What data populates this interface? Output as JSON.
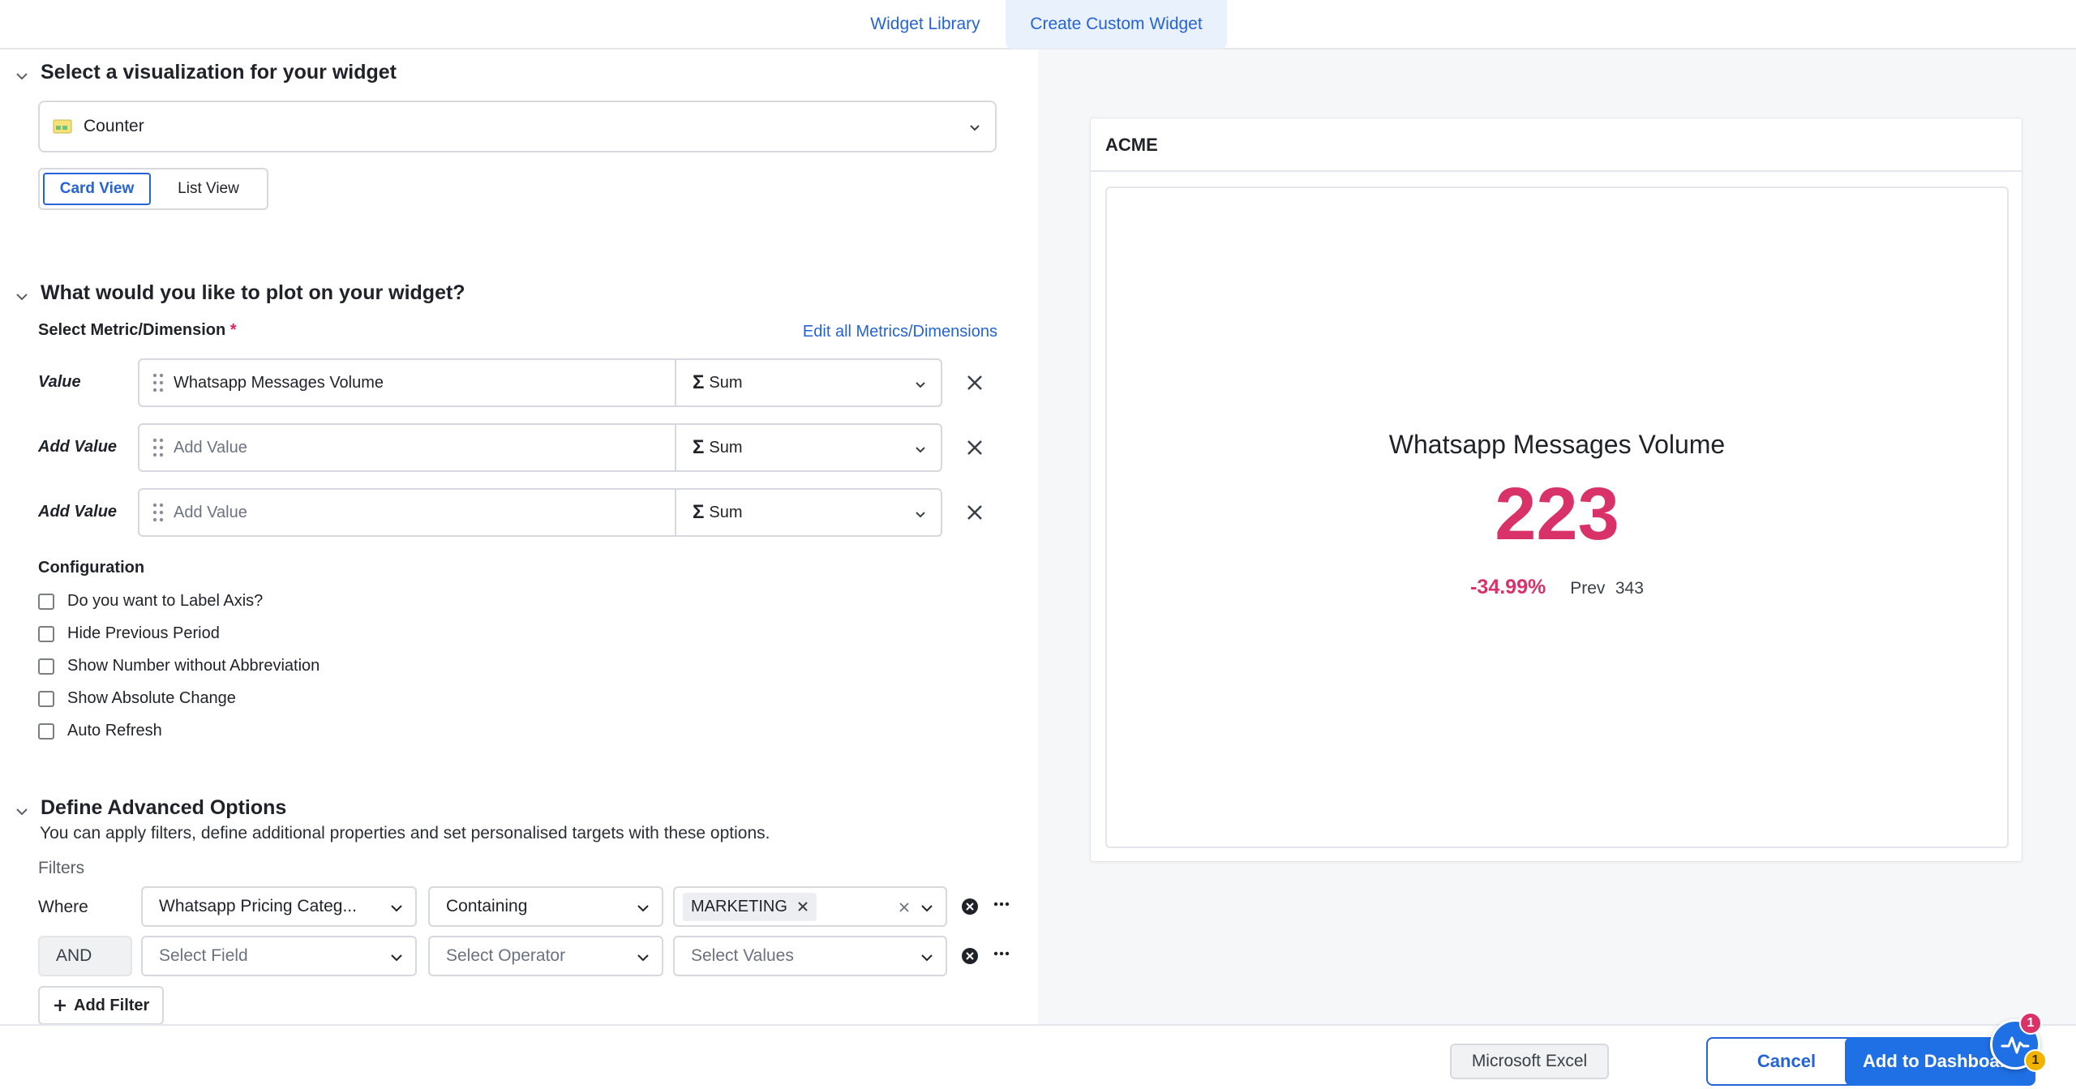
{
  "tabs": {
    "widget_library": "Widget Library",
    "create_custom_widget": "Create Custom Widget"
  },
  "visualization": {
    "heading": "Select a visualization for your widget",
    "selected": "Counter",
    "views": {
      "card": "Card View",
      "list": "List View",
      "active": "Card View"
    }
  },
  "plot": {
    "heading": "What would you like to plot on your widget?",
    "metric_label": "Select Metric/Dimension",
    "required_mark": "*",
    "edit_link": "Edit all Metrics/Dimensions",
    "rows": [
      {
        "label": "Value",
        "value": "Whatsapp Messages Volume",
        "placeholder": "",
        "aggregation": "Sum"
      },
      {
        "label": "Add Value",
        "value": "",
        "placeholder": "Add Value",
        "aggregation": "Sum"
      },
      {
        "label": "Add Value",
        "value": "",
        "placeholder": "Add Value",
        "aggregation": "Sum"
      }
    ],
    "sigma": "Σ"
  },
  "configuration": {
    "heading": "Configuration",
    "options": [
      {
        "label": "Do you want to Label Axis?",
        "checked": false
      },
      {
        "label": "Hide Previous Period",
        "checked": false
      },
      {
        "label": "Show Number without Abbreviation",
        "checked": false
      },
      {
        "label": "Show Absolute Change",
        "checked": false
      },
      {
        "label": "Auto Refresh",
        "checked": false
      }
    ]
  },
  "advanced": {
    "heading": "Define Advanced Options",
    "description": "You can apply filters, define additional properties and set personalised targets with these options.",
    "filters_label": "Filters",
    "filter_rows": [
      {
        "prefix": "Where",
        "field": "Whatsapp Pricing Categ...",
        "operator": "Containing",
        "value_chip": "MARKETING"
      },
      {
        "prefix": "AND",
        "field_placeholder": "Select Field",
        "operator_placeholder": "Select Operator",
        "values_placeholder": "Select Values"
      }
    ],
    "add_filter": "Add Filter"
  },
  "preview": {
    "card_title": "ACME",
    "metric_name": "Whatsapp Messages Volume",
    "metric_value": "223",
    "delta": "-34.99%",
    "prev_label": "Prev",
    "prev_value": "343",
    "accent": "#d93268"
  },
  "footer": {
    "cancel": "Cancel",
    "add_to_dashboard": "Add to Dashboard",
    "tooltip": "Microsoft Excel",
    "badge_red": "1",
    "badge_yellow": "1"
  },
  "colors": {
    "primary": "#2563d6",
    "accent": "#d93268"
  }
}
